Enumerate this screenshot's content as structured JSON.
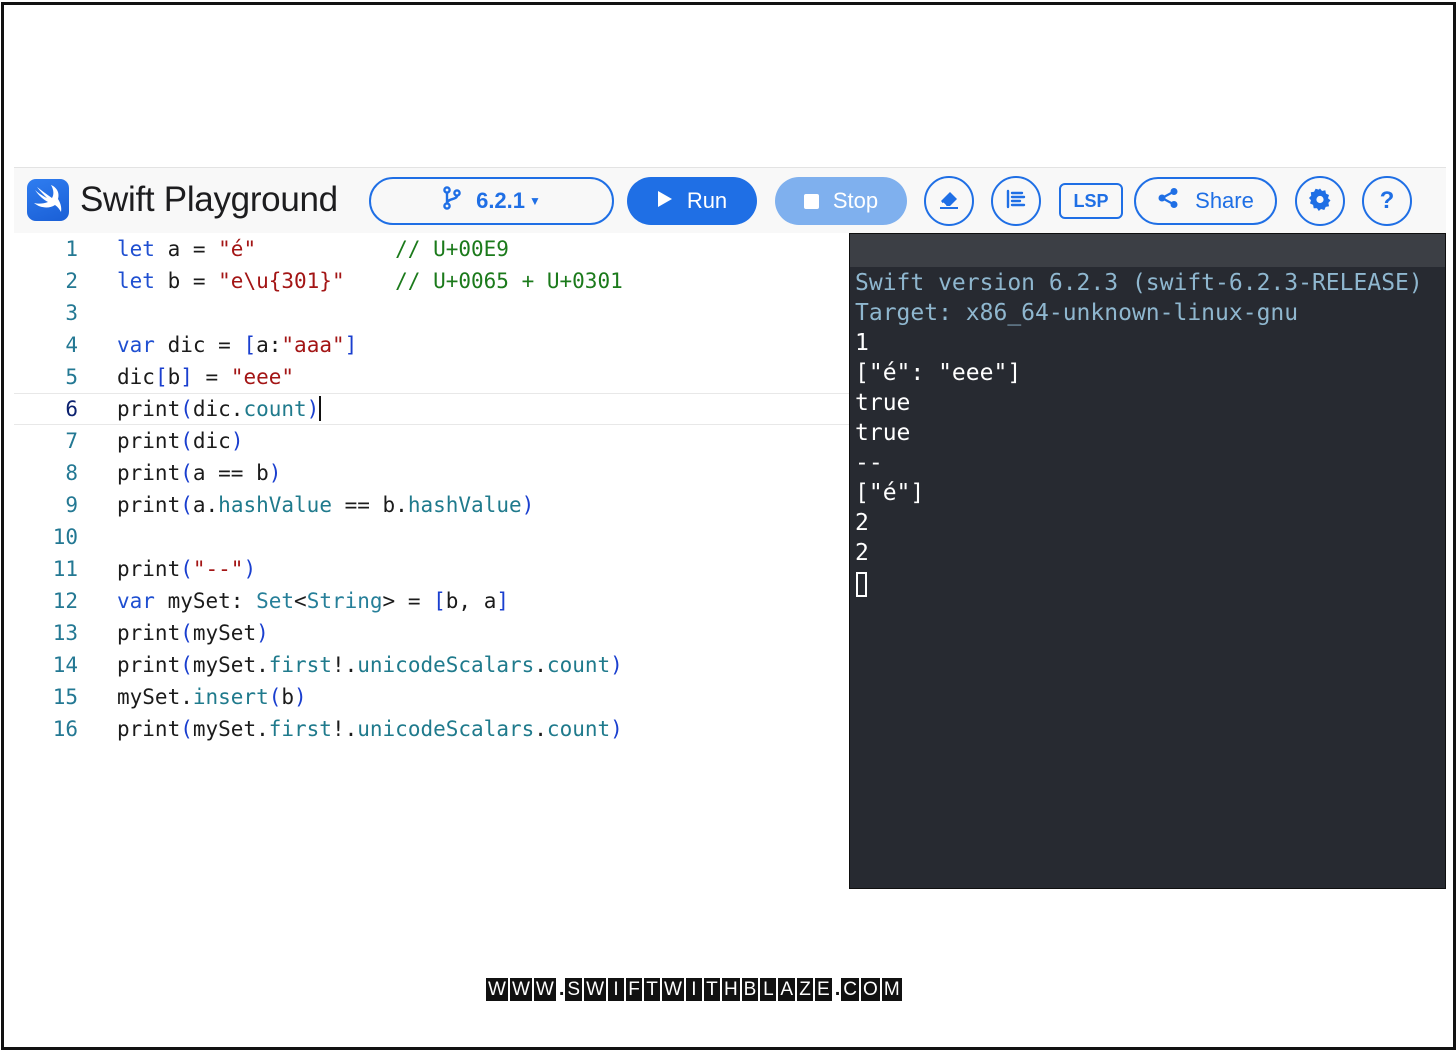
{
  "toolbar": {
    "app_title": "Swift Playground",
    "logo_icon": "swift-logo-icon",
    "version_label": "6.2.1",
    "run_label": "Run",
    "stop_label": "Stop",
    "lsp_label": "LSP",
    "share_label": "Share",
    "help_label": "?",
    "icons": [
      "branch-icon",
      "play-icon",
      "stop-icon",
      "eraser-icon",
      "format-icon",
      "share-icon",
      "gear-icon",
      "question-icon"
    ]
  },
  "editor": {
    "active_line": 6,
    "line_numbers": [
      "1",
      "2",
      "3",
      "4",
      "5",
      "6",
      "7",
      "8",
      "9",
      "10",
      "11",
      "12",
      "13",
      "14",
      "15",
      "16"
    ],
    "lines": [
      [
        {
          "t": "let",
          "c": "kw"
        },
        {
          "t": " a = ",
          "c": ""
        },
        {
          "t": "\"é\"",
          "c": "str"
        },
        {
          "t": "           // U+00E9",
          "c": "cmt"
        }
      ],
      [
        {
          "t": "let",
          "c": "kw"
        },
        {
          "t": " b = ",
          "c": ""
        },
        {
          "t": "\"e\\u{301}\"",
          "c": "str"
        },
        {
          "t": "    // U+0065 + U+0301",
          "c": "cmt"
        }
      ],
      [],
      [
        {
          "t": "var",
          "c": "kw"
        },
        {
          "t": " dic = ",
          "c": ""
        },
        {
          "t": "[",
          "c": "pn"
        },
        {
          "t": "a:",
          "c": ""
        },
        {
          "t": "\"aaa\"",
          "c": "str"
        },
        {
          "t": "]",
          "c": "pn"
        }
      ],
      [
        {
          "t": "dic",
          "c": ""
        },
        {
          "t": "[",
          "c": "pn"
        },
        {
          "t": "b",
          "c": ""
        },
        {
          "t": "]",
          "c": "pn"
        },
        {
          "t": " = ",
          "c": ""
        },
        {
          "t": "\"eee\"",
          "c": "str"
        }
      ],
      [
        {
          "t": "print",
          "c": ""
        },
        {
          "t": "(",
          "c": "pn"
        },
        {
          "t": "dic.",
          "c": ""
        },
        {
          "t": "count",
          "c": "mem"
        },
        {
          "t": ")",
          "c": "pn"
        }
      ],
      [
        {
          "t": "print",
          "c": ""
        },
        {
          "t": "(",
          "c": "pn"
        },
        {
          "t": "dic",
          "c": ""
        },
        {
          "t": ")",
          "c": "pn"
        }
      ],
      [
        {
          "t": "print",
          "c": ""
        },
        {
          "t": "(",
          "c": "pn"
        },
        {
          "t": "a == b",
          "c": ""
        },
        {
          "t": ")",
          "c": "pn"
        }
      ],
      [
        {
          "t": "print",
          "c": ""
        },
        {
          "t": "(",
          "c": "pn"
        },
        {
          "t": "a.",
          "c": ""
        },
        {
          "t": "hashValue",
          "c": "mem"
        },
        {
          "t": " == b.",
          "c": ""
        },
        {
          "t": "hashValue",
          "c": "mem"
        },
        {
          "t": ")",
          "c": "pn"
        }
      ],
      [],
      [
        {
          "t": "print",
          "c": ""
        },
        {
          "t": "(",
          "c": "pn"
        },
        {
          "t": "\"--\"",
          "c": "str"
        },
        {
          "t": ")",
          "c": "pn"
        }
      ],
      [
        {
          "t": "var",
          "c": "kw"
        },
        {
          "t": " mySet: ",
          "c": ""
        },
        {
          "t": "Set",
          "c": "ty"
        },
        {
          "t": "<",
          "c": ""
        },
        {
          "t": "String",
          "c": "ty"
        },
        {
          "t": "> = ",
          "c": ""
        },
        {
          "t": "[",
          "c": "pn"
        },
        {
          "t": "b, a",
          "c": ""
        },
        {
          "t": "]",
          "c": "pn"
        }
      ],
      [
        {
          "t": "print",
          "c": ""
        },
        {
          "t": "(",
          "c": "pn"
        },
        {
          "t": "mySet",
          "c": ""
        },
        {
          "t": ")",
          "c": "pn"
        }
      ],
      [
        {
          "t": "print",
          "c": ""
        },
        {
          "t": "(",
          "c": "pn"
        },
        {
          "t": "mySet.",
          "c": ""
        },
        {
          "t": "first",
          "c": "mem"
        },
        {
          "t": "!.",
          "c": ""
        },
        {
          "t": "unicodeScalars",
          "c": "mem"
        },
        {
          "t": ".",
          "c": ""
        },
        {
          "t": "count",
          "c": "mem"
        },
        {
          "t": ")",
          "c": "pn"
        }
      ],
      [
        {
          "t": "mySet.",
          "c": ""
        },
        {
          "t": "insert",
          "c": "mem"
        },
        {
          "t": "(",
          "c": "pn"
        },
        {
          "t": "b",
          "c": ""
        },
        {
          "t": ")",
          "c": "pn"
        }
      ],
      [
        {
          "t": "print",
          "c": ""
        },
        {
          "t": "(",
          "c": "pn"
        },
        {
          "t": "mySet.",
          "c": ""
        },
        {
          "t": "first",
          "c": "mem"
        },
        {
          "t": "!.",
          "c": ""
        },
        {
          "t": "unicodeScalars",
          "c": "mem"
        },
        {
          "t": ".",
          "c": ""
        },
        {
          "t": "count",
          "c": "mem"
        },
        {
          "t": ")",
          "c": "pn"
        }
      ]
    ]
  },
  "console": {
    "info_lines": [
      "Swift version 6.2.3 (swift-6.2.3-RELEASE)",
      "Target: x86_64-unknown-linux-gnu"
    ],
    "output_lines": [
      "1",
      "[\"é\": \"eee\"]",
      "true",
      "true",
      "--",
      "[\"é\"]",
      "2",
      "2"
    ]
  },
  "watermark": {
    "text": "WWW.SWIFTWITHBLAZE.COM"
  },
  "colors": {
    "accent": "#1f6fe5",
    "stop_disabled": "#7fb0ee",
    "console_bg": "#272a31",
    "keyword": "#1f4fd1",
    "string": "#a31515",
    "comment": "#1b7a1b"
  }
}
